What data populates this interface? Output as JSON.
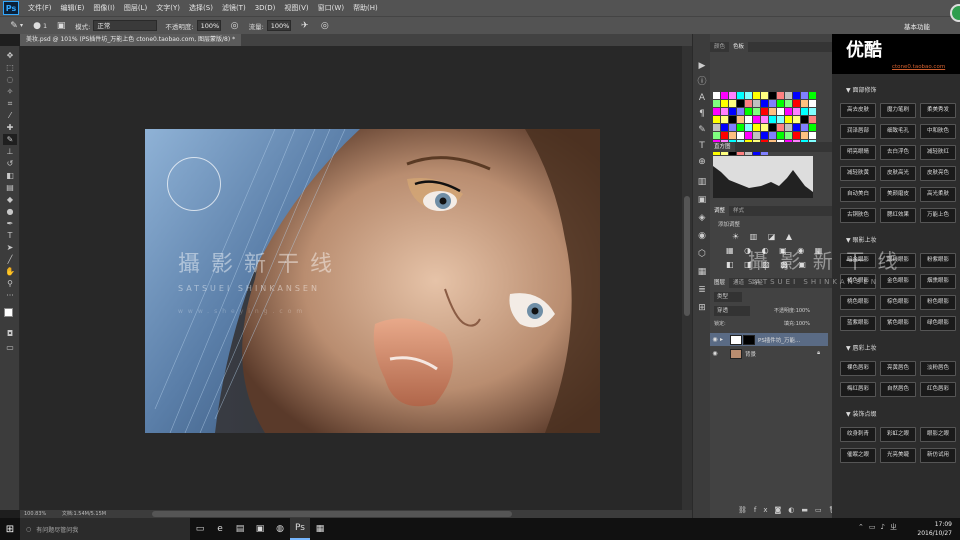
{
  "menubar": {
    "logo": "Ps",
    "items": [
      "文件(F)",
      "编辑(E)",
      "图像(I)",
      "图层(L)",
      "文字(Y)",
      "选择(S)",
      "滤镜(T)",
      "3D(D)",
      "视图(V)",
      "窗口(W)",
      "帮助(H)"
    ]
  },
  "options": {
    "brush_size": "1",
    "mode_label": "模式:",
    "mode_value": "正常",
    "opacity_label": "不透明度:",
    "opacity_value": "100%",
    "flow_label": "流量:",
    "flow_value": "100%",
    "workspace": "基本功能"
  },
  "document_tab": "美妆.psd @ 101% (PS插件坊_万能上色 ctone0.taobao.com, 图层蒙版/8) *",
  "status": {
    "zoom": "100.83%",
    "doc_info": "文档:1.54M/5.15M"
  },
  "panels": {
    "color_tabs": [
      "颜色",
      "色板"
    ],
    "histogram_title": "直方图",
    "adjust_tabs": [
      "调整",
      "样式"
    ],
    "adjust_add": "添加调整",
    "layers_tabs": [
      "图层",
      "通道",
      "路径"
    ],
    "layer_kind": "类型",
    "blend_mode": "穿透",
    "opacity_label": "不透明度:",
    "opacity_value": "100%",
    "lock_label": "锁定:",
    "fill_label": "填充:",
    "fill_value": "100%",
    "layers": [
      {
        "name": "PS插件坊_万能..."
      },
      {
        "name": "背景"
      }
    ]
  },
  "plugin": {
    "brand": "ctone0.taobao.com",
    "sections": [
      {
        "title": "▼ 面部修饰",
        "buttons": [
          "高去皮肤",
          "魔力笔刷",
          "柔美秀发",
          "润泽唇部",
          "细致毛孔",
          "中和肤色",
          "明亮眼睛",
          "去白浮色",
          "减轻肤红",
          "减轻肤黄",
          "皮肤高光",
          "皮肤亮色",
          "自动美白",
          "美颜磨皮",
          "高光柔肤",
          "古铜肤色",
          "腮红效果",
          "万能上色"
        ]
      },
      {
        "title": "▼ 眼影上妆",
        "buttons": [
          "暗金眼影",
          "眼线眼影",
          "粉紫眼影",
          "橘色眼影",
          "金色眼影",
          "烟熏眼影",
          "桃色眼影",
          "棕色眼影",
          "粉色眼影",
          "蓝紫眼影",
          "紫色眼影",
          "绿色眼影"
        ]
      },
      {
        "title": "▼ 唇彩上妆",
        "buttons": [
          "裸色唇彩",
          "亮黄唇色",
          "淡粉唇色",
          "梅红唇彩",
          "自然唇色",
          "红色唇彩"
        ]
      },
      {
        "title": "▼ 装饰点缀",
        "buttons": [
          "纹身刺青",
          "彩虹之眼",
          "眼影之眼",
          "催眠之眼",
          "光亮美睫",
          "新仿试用"
        ]
      }
    ]
  },
  "watermark": {
    "cn": "攝 影 新 干 线",
    "en": "SATSUEI SHINKANSEN",
    "url": "www.sheying.com",
    "corner": "优酷"
  },
  "taskbar": {
    "search_placeholder": "有问题尽管问我",
    "time": "17:09",
    "date": "2016/10/27"
  },
  "colors": {
    "menubar": "#535353",
    "panel": "#424242",
    "accent_blue": "#31a8ff",
    "hair_blue": "#5a7ea8"
  }
}
